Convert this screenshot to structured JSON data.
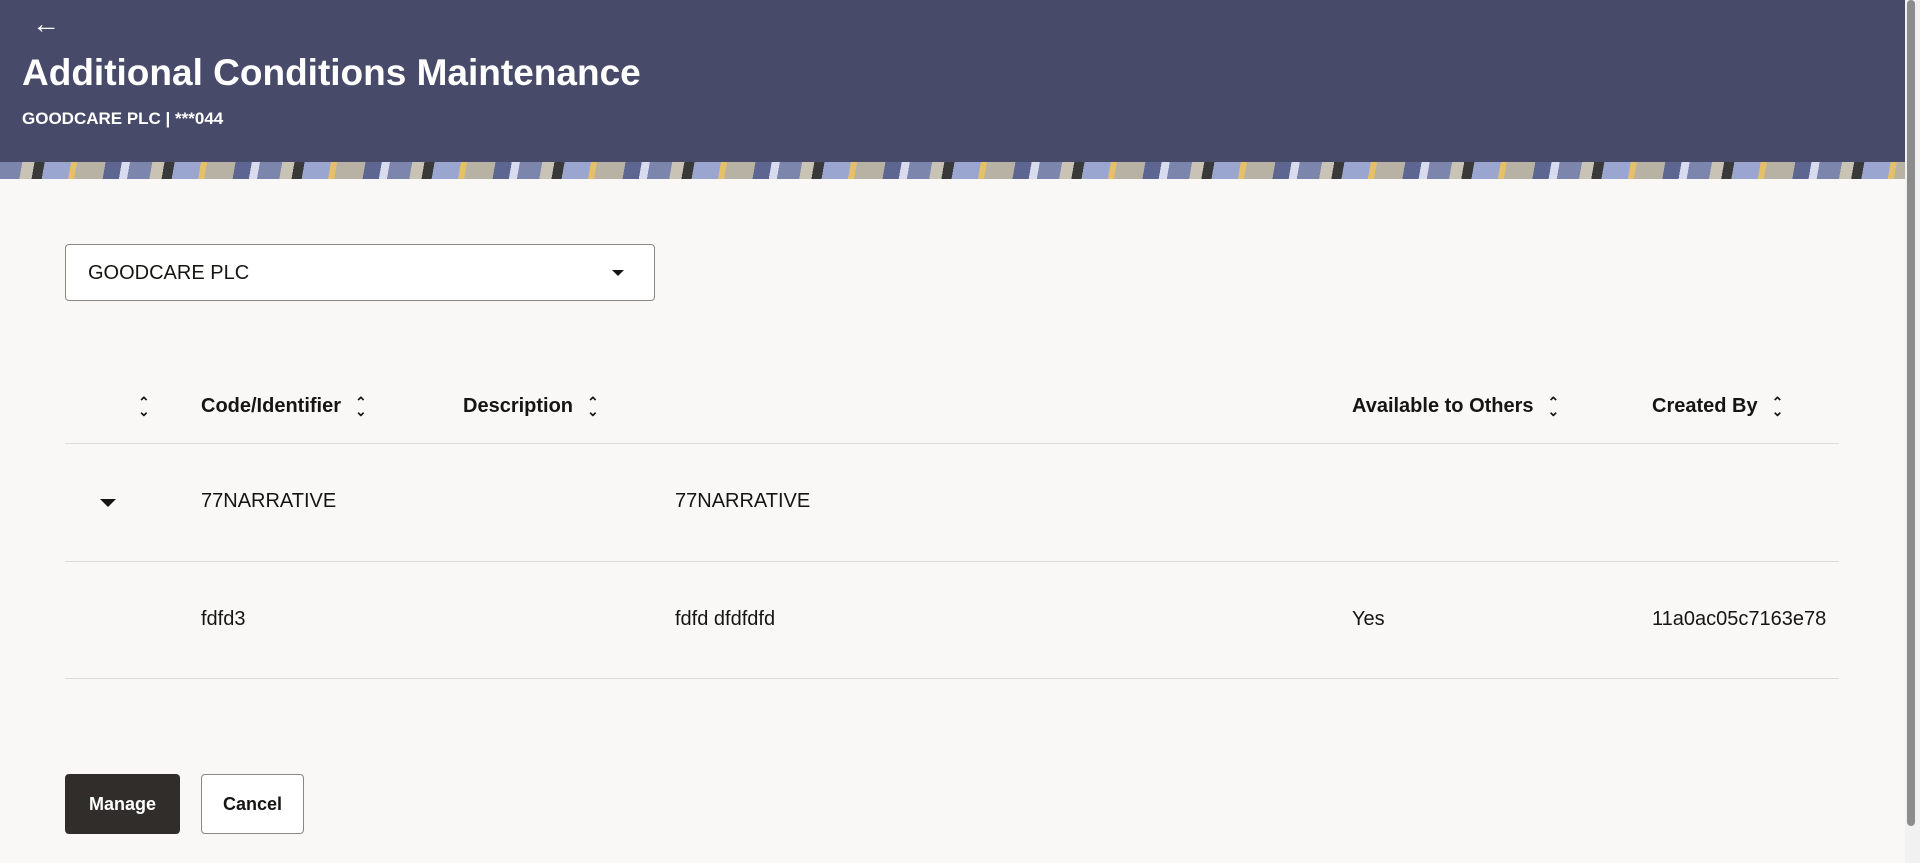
{
  "header": {
    "back_icon": "arrow-left-icon",
    "back_glyph": "←",
    "title": "Additional Conditions Maintenance",
    "subtitle": "GOODCARE PLC | ***044"
  },
  "party_select": {
    "value": "GOODCARE PLC"
  },
  "table": {
    "columns": [
      "Code/Identifier",
      "Description",
      "Available to Others",
      "Created By"
    ],
    "sort_glyph": "⌃⌄",
    "rows": [
      {
        "code": "77NARRATIVE",
        "description": "77NARRATIVE",
        "available": "",
        "created_by": ""
      },
      {
        "code": "fdfd3",
        "description": "fdfd dfdfdfd",
        "available": "Yes",
        "created_by": "11a0ac05c7163e78"
      }
    ]
  },
  "actions": {
    "manage": "Manage",
    "cancel": "Cancel"
  }
}
